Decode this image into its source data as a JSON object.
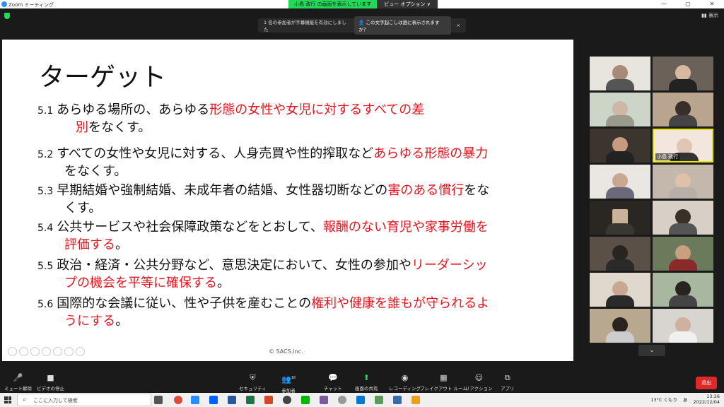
{
  "window": {
    "title": "Zoom ミーティング",
    "minimize": "—",
    "maximize": "▢",
    "close": "✕"
  },
  "share_banner": {
    "sharing": "小島 政行 の画面を表示しています",
    "view_options": "ビュー オプション ∨"
  },
  "display_button": "表示",
  "caption_bar": {
    "notice": "1 名の参加者が字幕機能を有効にしました",
    "question": "この文字起こしは誰に表示されますか？",
    "close": "×"
  },
  "slide": {
    "title": "ターゲット",
    "items": [
      {
        "num": "5.1",
        "line1_black": "あらゆる場所の、あらゆる",
        "line1_red": "形態の女性や女児に対するすべての差",
        "line2_red": "別",
        "line2_black": "をなくす。"
      },
      {
        "num": "5.2",
        "line1_black": "すべての女性や女児に対する、人身売買や性的搾取など",
        "line1_red": "あらゆる形態の暴力",
        "line2_black": "をなくす。"
      },
      {
        "num": "5.3",
        "line1_black": "早期結婚や強制結婚、未成年者の結婚、女性器切断などの",
        "line1_red": "害のある慣行",
        "line1_black2": "をな",
        "line2_black": "くす。"
      },
      {
        "num": "5.4",
        "line1_black": "公共サービスや社会保障政策などをとおして、",
        "line1_red": "報酬のない育児や家事労働を",
        "line2_red": "評価する",
        "line2_black": "。"
      },
      {
        "num": "5.5",
        "line1_black": "政治・経済・公共分野など、意思決定において、女性の参加や",
        "line1_red": "リーダーシッ",
        "line2_red": "プの機会を平等に確保する",
        "line2_black": "。"
      },
      {
        "num": "5.6",
        "line1_black": "国際的な会議に従い、性や子供を産むことの",
        "line1_red": "権利や健康を誰もが守られるよ",
        "line2_red": "うにする",
        "line2_black": "。"
      }
    ],
    "copyright": "© SACS.inc."
  },
  "gallery": {
    "active_name": "小島 政行",
    "scroll_icon": "chevron-down",
    "scroll_glyph": "⌄"
  },
  "toolbar": {
    "mute": "ミュート解除",
    "video": "ビデオの停止",
    "security": "セキュリティ",
    "participants": "参加者",
    "participants_count": "18",
    "chat": "チャット",
    "share": "画面の共有",
    "record": "レコーディング",
    "breakout": "ブレイクアウト ルーム",
    "reaction": "リアクション",
    "apps": "アプリ",
    "end": "退出"
  },
  "taskbar": {
    "search_placeholder": "ここに入力して検索",
    "weather": "13°C くもり",
    "ime": "あ",
    "time": "13:26",
    "date": "2022/12/04"
  },
  "colors": {
    "accent_red": "#e8141e",
    "share_green": "#23d959",
    "zoom_blue": "#2D8CFF",
    "end_red": "#e02828"
  }
}
